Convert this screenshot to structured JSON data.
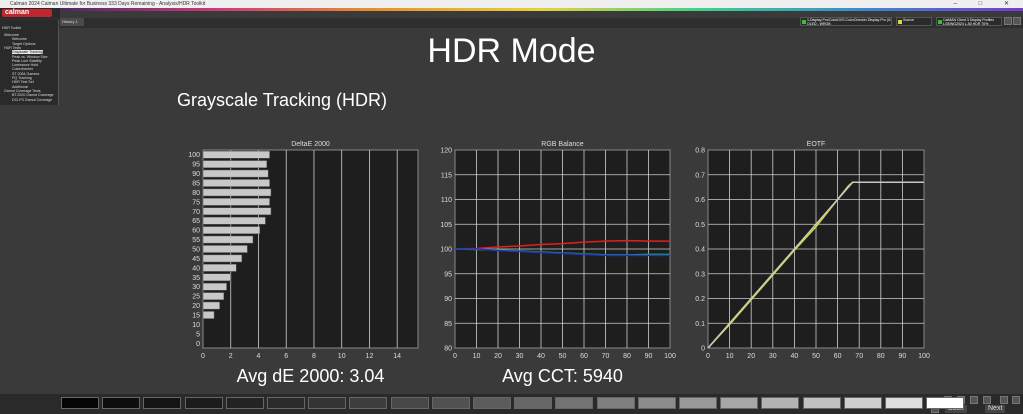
{
  "window": {
    "app_title": "Calman 2024 Calman Ultimate for Business 333 Days Remaining - Analysis/HDR Toolkit",
    "controls": "‒ □ ✕"
  },
  "logo": {
    "text": "calman"
  },
  "tabs": {
    "history": "History 1"
  },
  "sources": [
    {
      "label": "1-Display Pro/ColorDVS ColorChecker Display Pro (i1Disp)\nOLED - WRGB",
      "color": "#3bbf3b"
    },
    {
      "label": "Source",
      "color": "#d8d83b"
    },
    {
      "label": "CalMAN Client 3 Display Profiles\nLGEWG2024 L-50 HDR 70%",
      "color": "#3bbf3b"
    }
  ],
  "sidebar": {
    "header": "HDR Toolkit",
    "items": [
      {
        "label": "Welcome",
        "indent": 0
      },
      {
        "label": "Welcome",
        "indent": 1
      },
      {
        "label": "Target Options",
        "indent": 1
      },
      {
        "label": "HDR Tests",
        "indent": 0
      },
      {
        "label": "Grayscale Tracking",
        "indent": 1,
        "selected": true
      },
      {
        "label": "Peak vs. Window Size",
        "indent": 1
      },
      {
        "label": "Peak Lum Stability",
        "indent": 1
      },
      {
        "label": "Luminance Hold",
        "indent": 1
      },
      {
        "label": "Colorchecker",
        "indent": 1
      },
      {
        "label": "ST 2084 Gamma",
        "indent": 1
      },
      {
        "label": "PQ Tracking",
        "indent": 1
      },
      {
        "label": "HDR Test Set",
        "indent": 1
      },
      {
        "label": "Additional",
        "indent": 1
      },
      {
        "label": "Gamut Coverage Tests",
        "indent": 0
      },
      {
        "label": "BT.2020 Gamut Coverage",
        "indent": 1
      },
      {
        "label": "DCI-P3 Gamut Coverage",
        "indent": 1
      }
    ]
  },
  "main": {
    "title": "HDR Mode",
    "subtitle": "Grayscale Tracking (HDR)",
    "avg_de": "Avg dE 2000: 3.04",
    "avg_cct": "Avg CCT: 5940"
  },
  "chart_data": [
    {
      "type": "bar",
      "orientation": "horizontal",
      "title": "DeltaE 2000",
      "categories": [
        "100",
        "95",
        "90",
        "85",
        "80",
        "75",
        "70",
        "65",
        "60",
        "55",
        "50",
        "45",
        "40",
        "35",
        "30",
        "25",
        "20",
        "15",
        "10",
        "5",
        "0"
      ],
      "values": [
        4.8,
        4.6,
        4.7,
        4.8,
        4.9,
        4.8,
        4.9,
        4.5,
        4.1,
        3.6,
        3.2,
        2.8,
        2.4,
        2.0,
        1.7,
        1.5,
        1.2,
        0.8,
        0.0,
        0.0,
        0.0
      ],
      "xlim": [
        0,
        15.5
      ],
      "xticks": [
        "0",
        "2",
        "4",
        "6",
        "8",
        "10",
        "12",
        "14"
      ]
    },
    {
      "type": "line",
      "title": "RGB Balance",
      "x": [
        0,
        10,
        20,
        30,
        40,
        50,
        60,
        70,
        80,
        90,
        100
      ],
      "series": [
        {
          "color": "#e02020",
          "values": [
            100.0,
            100.1,
            100.4,
            100.6,
            100.9,
            101.1,
            101.4,
            101.6,
            101.7,
            101.6,
            101.6
          ]
        },
        {
          "color": "#20b020",
          "values": [
            100.0,
            99.9,
            99.8,
            99.6,
            99.4,
            99.2,
            99.0,
            98.8,
            98.8,
            98.9,
            98.9
          ]
        },
        {
          "color": "#2030d0",
          "values": [
            100.0,
            100.0,
            99.7,
            99.5,
            99.3,
            99.1,
            98.9,
            98.7,
            98.7,
            98.7,
            98.7
          ]
        }
      ],
      "xlim": [
        0,
        100
      ],
      "ylim": [
        80,
        120
      ],
      "xticks": [
        "0",
        "10",
        "20",
        "30",
        "40",
        "50",
        "60",
        "70",
        "80",
        "90",
        "100"
      ],
      "yticks": [
        "80",
        "85",
        "90",
        "95",
        "100",
        "105",
        "110",
        "115",
        "120"
      ]
    },
    {
      "type": "line",
      "title": "EOTF",
      "x": [
        0,
        10,
        20,
        30,
        40,
        50,
        60,
        65,
        67,
        70,
        80,
        90,
        100
      ],
      "series": [
        {
          "color": "#d8d820",
          "values": [
            0.0,
            0.095,
            0.195,
            0.295,
            0.395,
            0.49,
            0.6,
            0.655,
            0.67,
            0.67,
            0.67,
            0.67,
            0.67
          ]
        },
        {
          "color": "#c8c8c8",
          "values": [
            0.0,
            0.1,
            0.2,
            0.3,
            0.4,
            0.5,
            0.6,
            0.65,
            0.67,
            0.67,
            0.67,
            0.67,
            0.67
          ]
        }
      ],
      "xlim": [
        0,
        100
      ],
      "ylim": [
        0,
        0.8
      ],
      "xticks": [
        "0",
        "10",
        "20",
        "30",
        "40",
        "50",
        "60",
        "70",
        "80",
        "90",
        "100"
      ],
      "yticks": [
        "0",
        "0.1",
        "0.2",
        "0.3",
        "0.4",
        "0.5",
        "0.6",
        "0.7",
        "0.8"
      ]
    }
  ],
  "swatches": [
    "#050505",
    "#0d0d0d",
    "#141414",
    "#1c1c1c",
    "#232323",
    "#2b2b2b",
    "#343434",
    "#3d3d3d",
    "#474747",
    "#515151",
    "#5c5c5c",
    "#676767",
    "#737373",
    "#7f7f7f",
    "#8c8c8c",
    "#999999",
    "#a6a6a6",
    "#b3b3b3",
    "#c1c1c1",
    "#cfcfcf",
    "#dddddd",
    "#ffffff"
  ],
  "footer": {
    "back": "Back",
    "next": "Next"
  }
}
